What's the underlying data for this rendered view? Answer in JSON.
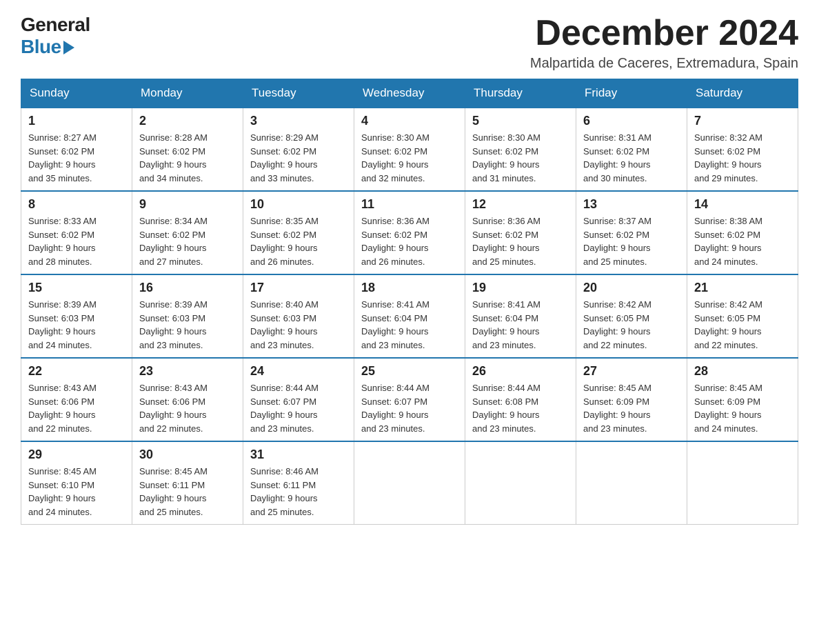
{
  "header": {
    "logo_line1": "General",
    "logo_line2": "Blue",
    "month_title": "December 2024",
    "location": "Malpartida de Caceres, Extremadura, Spain"
  },
  "weekdays": [
    "Sunday",
    "Monday",
    "Tuesday",
    "Wednesday",
    "Thursday",
    "Friday",
    "Saturday"
  ],
  "weeks": [
    [
      {
        "day": "1",
        "sunrise": "8:27 AM",
        "sunset": "6:02 PM",
        "daylight": "9 hours and 35 minutes."
      },
      {
        "day": "2",
        "sunrise": "8:28 AM",
        "sunset": "6:02 PM",
        "daylight": "9 hours and 34 minutes."
      },
      {
        "day": "3",
        "sunrise": "8:29 AM",
        "sunset": "6:02 PM",
        "daylight": "9 hours and 33 minutes."
      },
      {
        "day": "4",
        "sunrise": "8:30 AM",
        "sunset": "6:02 PM",
        "daylight": "9 hours and 32 minutes."
      },
      {
        "day": "5",
        "sunrise": "8:30 AM",
        "sunset": "6:02 PM",
        "daylight": "9 hours and 31 minutes."
      },
      {
        "day": "6",
        "sunrise": "8:31 AM",
        "sunset": "6:02 PM",
        "daylight": "9 hours and 30 minutes."
      },
      {
        "day": "7",
        "sunrise": "8:32 AM",
        "sunset": "6:02 PM",
        "daylight": "9 hours and 29 minutes."
      }
    ],
    [
      {
        "day": "8",
        "sunrise": "8:33 AM",
        "sunset": "6:02 PM",
        "daylight": "9 hours and 28 minutes."
      },
      {
        "day": "9",
        "sunrise": "8:34 AM",
        "sunset": "6:02 PM",
        "daylight": "9 hours and 27 minutes."
      },
      {
        "day": "10",
        "sunrise": "8:35 AM",
        "sunset": "6:02 PM",
        "daylight": "9 hours and 26 minutes."
      },
      {
        "day": "11",
        "sunrise": "8:36 AM",
        "sunset": "6:02 PM",
        "daylight": "9 hours and 26 minutes."
      },
      {
        "day": "12",
        "sunrise": "8:36 AM",
        "sunset": "6:02 PM",
        "daylight": "9 hours and 25 minutes."
      },
      {
        "day": "13",
        "sunrise": "8:37 AM",
        "sunset": "6:02 PM",
        "daylight": "9 hours and 25 minutes."
      },
      {
        "day": "14",
        "sunrise": "8:38 AM",
        "sunset": "6:02 PM",
        "daylight": "9 hours and 24 minutes."
      }
    ],
    [
      {
        "day": "15",
        "sunrise": "8:39 AM",
        "sunset": "6:03 PM",
        "daylight": "9 hours and 24 minutes."
      },
      {
        "day": "16",
        "sunrise": "8:39 AM",
        "sunset": "6:03 PM",
        "daylight": "9 hours and 23 minutes."
      },
      {
        "day": "17",
        "sunrise": "8:40 AM",
        "sunset": "6:03 PM",
        "daylight": "9 hours and 23 minutes."
      },
      {
        "day": "18",
        "sunrise": "8:41 AM",
        "sunset": "6:04 PM",
        "daylight": "9 hours and 23 minutes."
      },
      {
        "day": "19",
        "sunrise": "8:41 AM",
        "sunset": "6:04 PM",
        "daylight": "9 hours and 23 minutes."
      },
      {
        "day": "20",
        "sunrise": "8:42 AM",
        "sunset": "6:05 PM",
        "daylight": "9 hours and 22 minutes."
      },
      {
        "day": "21",
        "sunrise": "8:42 AM",
        "sunset": "6:05 PM",
        "daylight": "9 hours and 22 minutes."
      }
    ],
    [
      {
        "day": "22",
        "sunrise": "8:43 AM",
        "sunset": "6:06 PM",
        "daylight": "9 hours and 22 minutes."
      },
      {
        "day": "23",
        "sunrise": "8:43 AM",
        "sunset": "6:06 PM",
        "daylight": "9 hours and 22 minutes."
      },
      {
        "day": "24",
        "sunrise": "8:44 AM",
        "sunset": "6:07 PM",
        "daylight": "9 hours and 23 minutes."
      },
      {
        "day": "25",
        "sunrise": "8:44 AM",
        "sunset": "6:07 PM",
        "daylight": "9 hours and 23 minutes."
      },
      {
        "day": "26",
        "sunrise": "8:44 AM",
        "sunset": "6:08 PM",
        "daylight": "9 hours and 23 minutes."
      },
      {
        "day": "27",
        "sunrise": "8:45 AM",
        "sunset": "6:09 PM",
        "daylight": "9 hours and 23 minutes."
      },
      {
        "day": "28",
        "sunrise": "8:45 AM",
        "sunset": "6:09 PM",
        "daylight": "9 hours and 24 minutes."
      }
    ],
    [
      {
        "day": "29",
        "sunrise": "8:45 AM",
        "sunset": "6:10 PM",
        "daylight": "9 hours and 24 minutes."
      },
      {
        "day": "30",
        "sunrise": "8:45 AM",
        "sunset": "6:11 PM",
        "daylight": "9 hours and 25 minutes."
      },
      {
        "day": "31",
        "sunrise": "8:46 AM",
        "sunset": "6:11 PM",
        "daylight": "9 hours and 25 minutes."
      },
      null,
      null,
      null,
      null
    ]
  ],
  "labels": {
    "sunrise": "Sunrise:",
    "sunset": "Sunset:",
    "daylight": "Daylight:"
  }
}
